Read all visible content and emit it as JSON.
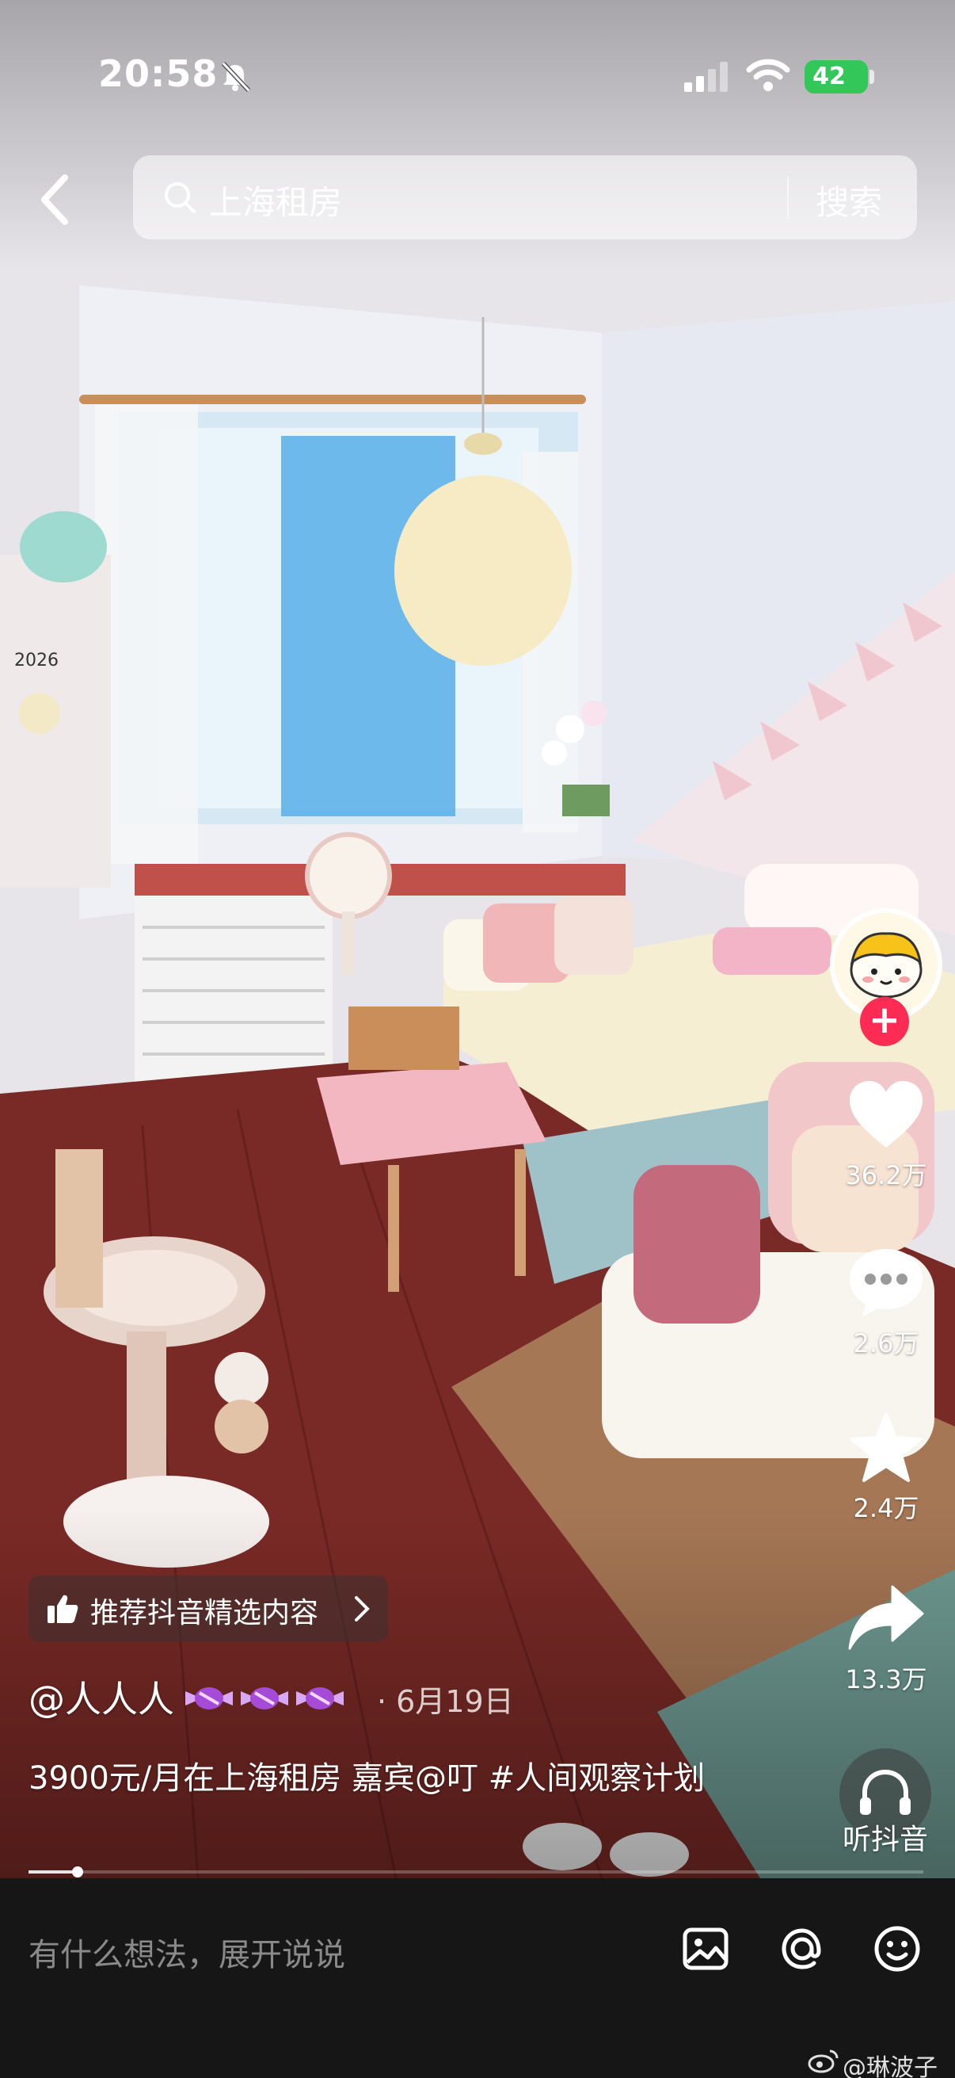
{
  "status_bar": {
    "time": "20:58",
    "battery": "42"
  },
  "search": {
    "query": "上海租房",
    "button": "搜索"
  },
  "actions": {
    "likes": "36.2万",
    "comments": "2.6万",
    "favorites": "2.4万",
    "shares": "13.3万",
    "listen": "听抖音"
  },
  "recommend_label": "推荐抖音精选内容",
  "post": {
    "author": "@人人人",
    "date": "· 6月19日",
    "caption": "3900元/月在上海租房 嘉宾@叮 #人间观察计划",
    "progress": 0.055
  },
  "comment_bar": {
    "placeholder": "有什么想法，展开说说"
  },
  "watermark": "@琳波子",
  "scene_text": {
    "calendar_year": "2026"
  },
  "icons": [
    "back-icon",
    "search-icon",
    "mute-bell-icon",
    "signal-icon",
    "wifi-icon",
    "heart-icon",
    "comment-icon",
    "star-icon",
    "share-icon",
    "headphones-icon",
    "thumb-up-icon",
    "image-icon",
    "at-icon",
    "emoji-icon",
    "weibo-icon"
  ],
  "colors": {
    "follow": "#fe2c55",
    "battery": "#33c759",
    "comment_bar": "#161616"
  }
}
